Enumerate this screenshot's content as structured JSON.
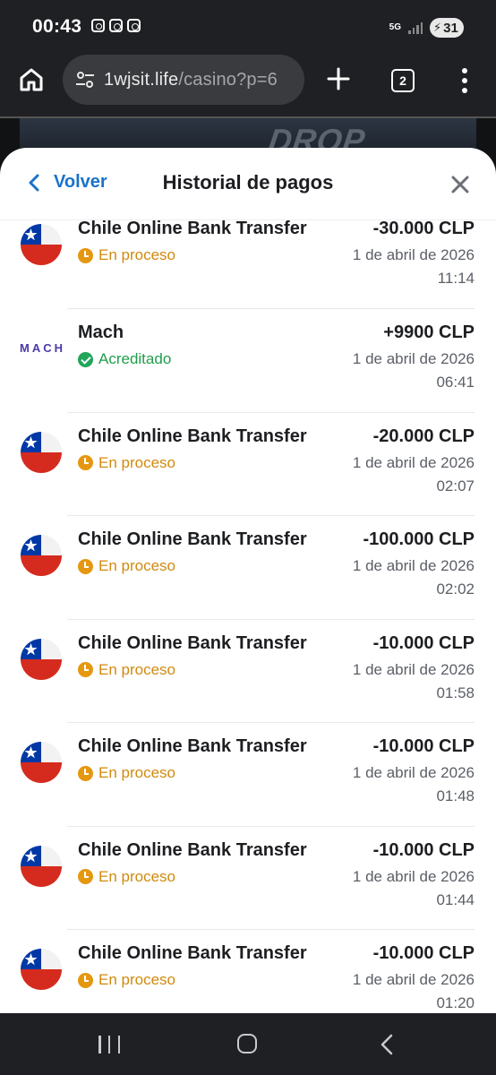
{
  "status_bar": {
    "time": "00:43",
    "network": "5G",
    "battery": "31"
  },
  "browser": {
    "url_domain": "1wjsit.life",
    "url_path": "/casino?p=6",
    "tab_count": "2"
  },
  "background": {
    "promo_text": "DROP"
  },
  "sheet": {
    "back_label": "Volver",
    "title": "Historial de pagos"
  },
  "payments": [
    {
      "method": "Chile Online Bank Transfer",
      "logo": "chile-flag",
      "status": "En proceso",
      "status_type": "pending",
      "amount": "-30.000 CLP",
      "date": "1 de abril de 2026",
      "time": "11:14"
    },
    {
      "method": "Mach",
      "logo": "mach-logo",
      "logo_text": "MACH",
      "status": "Acreditado",
      "status_type": "ok",
      "amount": "+9900 CLP",
      "date": "1 de abril de 2026",
      "time": "06:41"
    },
    {
      "method": "Chile Online Bank Transfer",
      "logo": "chile-flag",
      "status": "En proceso",
      "status_type": "pending",
      "amount": "-20.000 CLP",
      "date": "1 de abril de 2026",
      "time": "02:07"
    },
    {
      "method": "Chile Online Bank Transfer",
      "logo": "chile-flag",
      "status": "En proceso",
      "status_type": "pending",
      "amount": "-100.000 CLP",
      "date": "1 de abril de 2026",
      "time": "02:02"
    },
    {
      "method": "Chile Online Bank Transfer",
      "logo": "chile-flag",
      "status": "En proceso",
      "status_type": "pending",
      "amount": "-10.000 CLP",
      "date": "1 de abril de 2026",
      "time": "01:58"
    },
    {
      "method": "Chile Online Bank Transfer",
      "logo": "chile-flag",
      "status": "En proceso",
      "status_type": "pending",
      "amount": "-10.000 CLP",
      "date": "1 de abril de 2026",
      "time": "01:48"
    },
    {
      "method": "Chile Online Bank Transfer",
      "logo": "chile-flag",
      "status": "En proceso",
      "status_type": "pending",
      "amount": "-10.000 CLP",
      "date": "1 de abril de 2026",
      "time": "01:44"
    },
    {
      "method": "Chile Online Bank Transfer",
      "logo": "chile-flag",
      "status": "En proceso",
      "status_type": "pending",
      "amount": "-10.000 CLP",
      "date": "1 de abril de 2026",
      "time": "01:20"
    }
  ],
  "colors": {
    "accent": "#1a73c9",
    "pending": "#e5980f",
    "credited": "#21a65a",
    "chrome_dark": "#1f2023"
  }
}
